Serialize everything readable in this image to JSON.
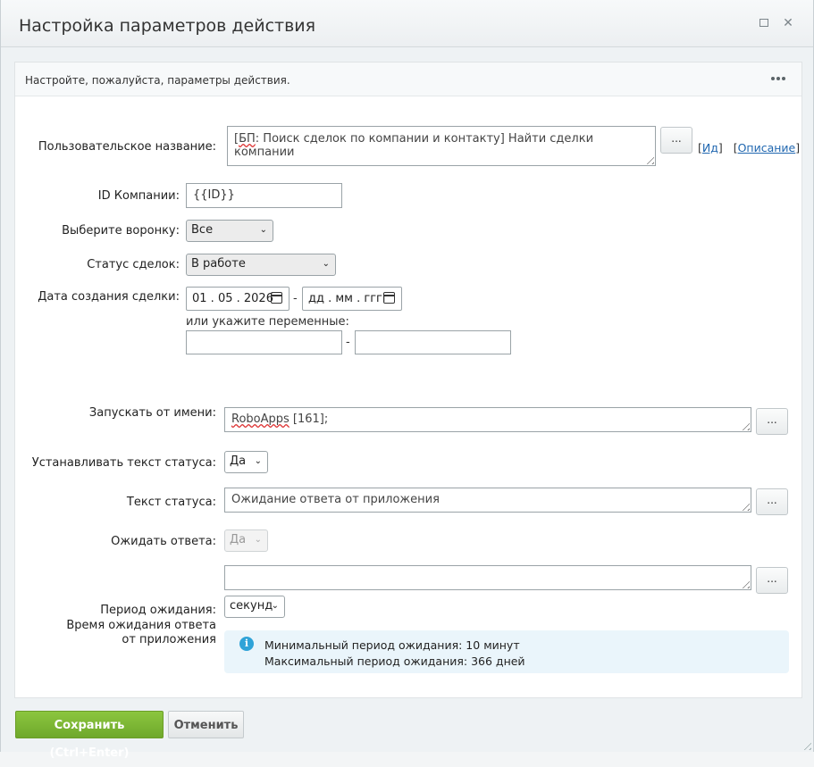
{
  "window": {
    "title": "Настройка параметров действия"
  },
  "panel": {
    "hint": "Настройте, пожалуйста, параметры действия."
  },
  "fields": {
    "custom_name": {
      "label": "Пользовательское название:",
      "value_prefix": "[",
      "value_squiggle": "БП",
      "value_rest": ": Поиск сделок по компании и контакту] Найти сделки компании",
      "dots": "...",
      "id_link": "Ид",
      "desc_link": "Описание",
      "bracket_open": "[",
      "bracket_close": "]"
    },
    "company_id": {
      "label": "ID Компании:",
      "value": "{{ID}}"
    },
    "funnel": {
      "label": "Выберите воронку:",
      "selected": "Все"
    },
    "deal_status": {
      "label": "Статус сделок:",
      "selected": "В работе"
    },
    "created_date": {
      "label": "Дата создания сделки:",
      "from": "01 . 05 . 2026",
      "to": "дд . мм . гггг",
      "dash": "-",
      "or_vars": "или укажите переменные:"
    },
    "run_as": {
      "label": "Запускать от имени:",
      "value_squiggle": "RoboApps",
      "value_rest": " [161];",
      "dots": "..."
    },
    "set_status_text": {
      "label": "Устанавливать текст статуса:",
      "selected": "Да"
    },
    "status_text": {
      "label": "Текст статуса:",
      "value": "Ожидание ответа от приложения",
      "dots": "..."
    },
    "wait_response": {
      "label": "Ожидать ответа:",
      "selected": "Да"
    },
    "wait_period": {
      "label": "Период ожидания:",
      "unit": "секунд",
      "dots": "..."
    },
    "wait_time": {
      "label": "Время ожидания ответа от приложения"
    }
  },
  "info": {
    "icon": "info-icon",
    "min": "Минимальный период ожидания: 10 минут",
    "max": "Максимальный период ожидания: 366 дней"
  },
  "footer": {
    "save": "Сохранить (Ctrl+Enter)",
    "cancel": "Отменить"
  },
  "colors": {
    "accent_green": "#7cb833",
    "link": "#2067b0",
    "info_bg": "#eaf5fb"
  }
}
